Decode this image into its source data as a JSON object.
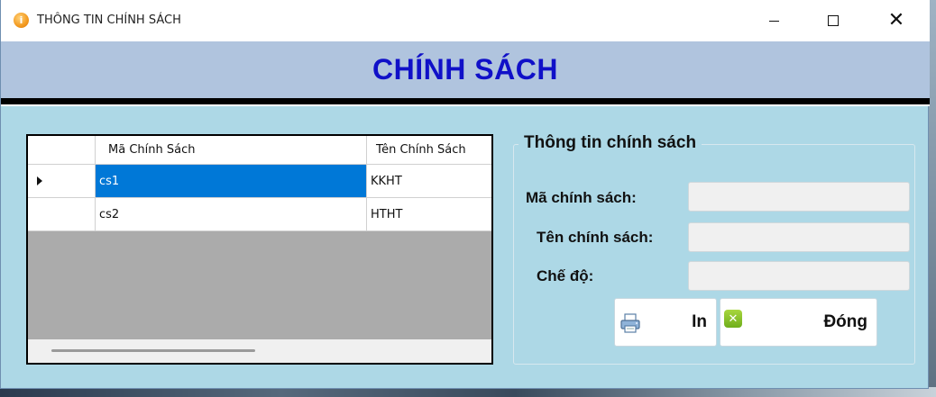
{
  "window": {
    "title": "THÔNG TIN CHÍNH SÁCH",
    "app_icon_glyph": "i",
    "controls": {
      "minimize": "minimize-icon",
      "maximize": "maximize-icon",
      "close": "close-icon"
    }
  },
  "header": {
    "title": "CHÍNH SÁCH",
    "title_color": "#1010c8",
    "band_color": "#b0c4de"
  },
  "grid": {
    "columns": [
      "",
      "Mã Chính Sách",
      "Tên Chính Sách"
    ],
    "rows": [
      {
        "ma": "cs1",
        "ten": "KKHT",
        "selected": true
      },
      {
        "ma": "cs2",
        "ten": "HTHT",
        "selected": false
      }
    ],
    "selection_color": "#0078d7"
  },
  "details": {
    "legend": "Thông tin chính sách",
    "fields": [
      {
        "label": "Mã chính sách:",
        "value": ""
      },
      {
        "label": "Tên chính sách:",
        "value": ""
      },
      {
        "label": "Chế độ:",
        "value": ""
      }
    ]
  },
  "buttons": {
    "print_label": "In",
    "print_icon": "printer-icon",
    "close_label": "Đóng",
    "close_icon": "close-x-icon"
  },
  "colors": {
    "window_bg": "#add8e6"
  }
}
